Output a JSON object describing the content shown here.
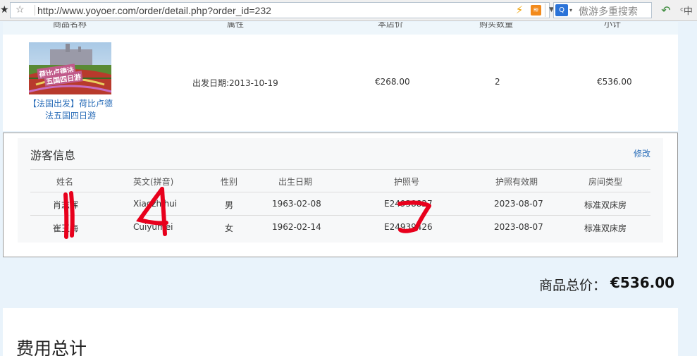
{
  "browser": {
    "url": "http://www.yoyoer.com/order/detail.php?order_id=232",
    "search_placeholder": "傲游多重搜索",
    "icons": [
      "star-icon",
      "bolt-icon",
      "rss-icon",
      "dropdown-icon",
      "search-engine-icon",
      "translate-icon",
      "undo-icon"
    ]
  },
  "product_table": {
    "headers": [
      "商品名称",
      "属性",
      "本店价",
      "购买数量",
      "小计"
    ],
    "row": {
      "name": "【法国出发】荷比卢德法五国四日游",
      "thumb_caption_line1": "荷比卢德法",
      "thumb_caption_line2": "五国四日游",
      "attribute": "出发日期:2013-10-19",
      "price": "€268.00",
      "quantity": "2",
      "subtotal": "€536.00"
    }
  },
  "travellers": {
    "title": "游客信息",
    "edit": "修改",
    "headers": [
      "姓名",
      "英文(拼音)",
      "性别",
      "出生日期",
      "护照号",
      "护照有效期",
      "房间类型"
    ],
    "rows": [
      {
        "name": "肖志辉",
        "pinyin": "Xiaozhihui",
        "gender": "男",
        "birth": "1963-02-08",
        "passport": "E24938827",
        "expiry": "2023-08-07",
        "room": "标准双床房"
      },
      {
        "name": "崔玉梅",
        "pinyin": "Cuiyumei",
        "gender": "女",
        "birth": "1962-02-14",
        "passport": "E24939426",
        "expiry": "2023-08-07",
        "room": "标准双床房"
      }
    ]
  },
  "total": {
    "label": "商品总价：",
    "value": "€536.00"
  },
  "fees": {
    "title": "费用总计"
  },
  "colors": {
    "link": "#2a6db8",
    "page_bg": "#e9f3fb",
    "annotation": "#e8001c"
  }
}
